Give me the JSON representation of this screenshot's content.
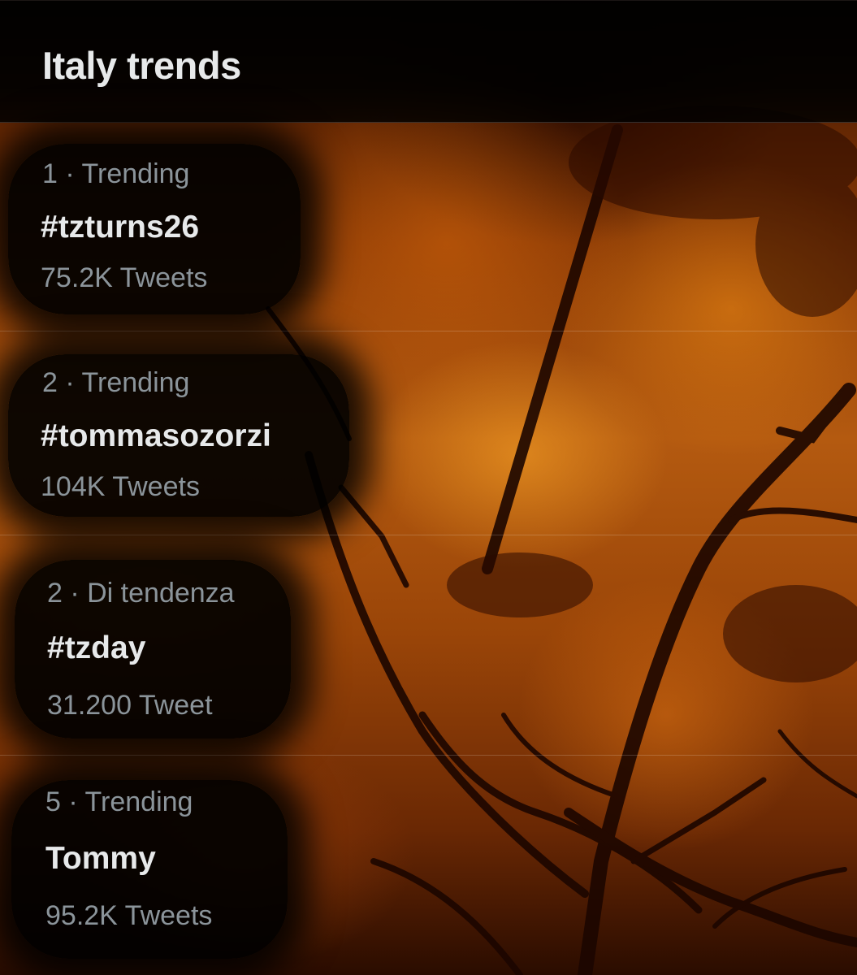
{
  "header": {
    "title": "Italy trends"
  },
  "trends": [
    {
      "meta": "1 · Trending",
      "name": "#tzturns26",
      "count": "75.2K Tweets"
    },
    {
      "meta": "2 · Trending",
      "name": "#tommasozorzi",
      "count": "104K Tweets"
    },
    {
      "meta": "2 · Di tendenza",
      "name": "#tzday",
      "count": "31.200 Tweet"
    },
    {
      "meta": "5 · Trending",
      "name": "Tommy",
      "count": "95.2K Tweets"
    }
  ],
  "colors": {
    "primary_text": "#e7e9ea",
    "secondary_text": "#8b949a",
    "background_overlay": "#000000",
    "fire_accent": "#d2781a"
  }
}
